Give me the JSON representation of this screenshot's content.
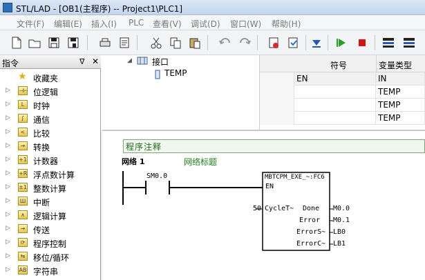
{
  "window": {
    "title": "STL/LAD - [OB1(主程序) -- Project1\\PLC1]"
  },
  "menu": [
    "文件(F)",
    "编辑(E)",
    "插入(I)",
    "PLC",
    "查看(V)",
    "调试(D)",
    "窗口(W)",
    "帮助(H)"
  ],
  "left_panel": {
    "title": "指令",
    "pin": "ᐁ",
    "close": "✕",
    "items": [
      "收藏夹",
      "位逻辑",
      "时钟",
      "通信",
      "比较",
      "转换",
      "计数器",
      "浮点数计算",
      "整数计算",
      "中断",
      "逻辑计算",
      "传送",
      "程序控制",
      "移位/循环",
      "字符串"
    ],
    "icon_glyphs": [
      "",
      "⊣⊢",
      "L",
      "ʃ",
      "<",
      "→",
      "+1",
      "+R",
      "±1",
      "Ш",
      "∧",
      "→",
      "⟳",
      "⇆",
      "AB"
    ]
  },
  "interface": {
    "root": "接口",
    "child": "TEMP"
  },
  "var_table": {
    "headers": [
      "符号",
      "变量类型"
    ],
    "rows": [
      [
        "EN",
        "IN"
      ],
      [
        "",
        "TEMP"
      ],
      [
        "",
        "TEMP"
      ],
      [
        "",
        "TEMP"
      ]
    ]
  },
  "editor": {
    "comment": "程序注释",
    "network_label": "网络 1",
    "network_title": "网络标题",
    "contact": "SM0.0",
    "block": {
      "name": "MBTCPM_EXE_~:FC6",
      "en": "EN",
      "inputs": [
        {
          "pin": "CycleT~",
          "value": "50"
        }
      ],
      "outputs": [
        {
          "pin": "Done",
          "value": "M0.0"
        },
        {
          "pin": "Error",
          "value": "M0.1"
        },
        {
          "pin": "ErrorS~",
          "value": "LB0"
        },
        {
          "pin": "ErrorC~",
          "value": "LB1"
        }
      ]
    }
  },
  "colors": {
    "comment_text": "#1a6d1a",
    "network_title": "#1f7f1f",
    "play": "#2a9d2a",
    "stop": "#d21414"
  }
}
